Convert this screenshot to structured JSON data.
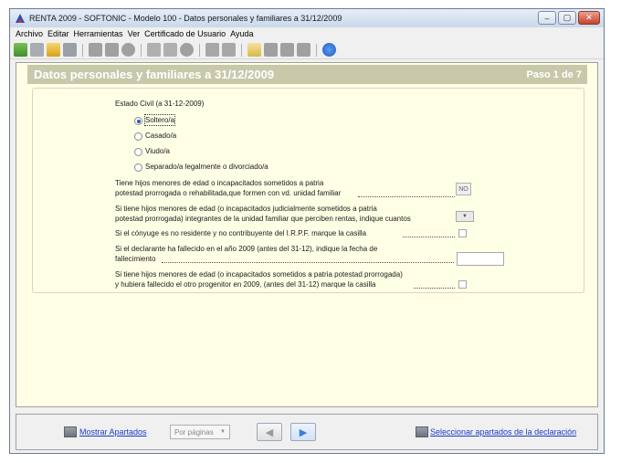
{
  "window": {
    "title": "RENTA 2009 - SOFTONIC - Modelo 100 - Datos personales y familiares a 31/12/2009",
    "minimize": "‒",
    "maximize": "▢",
    "close": "✕"
  },
  "menu": [
    "Archivo",
    "Editar",
    "Herramientas",
    "Ver",
    "Certificado de Usuario",
    "Ayuda"
  ],
  "header": {
    "title": "Datos personales y familiares a 31/12/2009",
    "step": "Paso 1 de 7"
  },
  "form": {
    "estado_civil_label": "Estado Civil (a 31-12-2009)",
    "options": [
      "Soltero/a",
      "Casado/a",
      "Viudo/a",
      "Separado/a legalmente o divorciado/a"
    ],
    "selected_option": "Soltero/a",
    "q1_line1": "Tiene hijos menores de edad o incapacitados sometidos a patria",
    "q1_line2": "potestad prorrogada o rehabilitada,que formen con vd. unidad familiar",
    "q1_value": "NO",
    "q2_line1": "Si tiene hijos menores de edad (o incapacitados judicialmente sometidos a patria",
    "q2_line2": "potestad prorrogada) integrantes de la unidad familiar que perciben rentas, indique cuantos",
    "q3": "Si el cónyuge es no residente y no contribuyente del I.R.P.F. marque la casilla",
    "q4_line1": "Si el declarante ha fallecido en el año 2009 (antes del 31-12), indique la fecha de",
    "q4_line2": "fallecimiento",
    "q5_line1": "Si tiene hijos menores de edad (o incapacitados sometidos a patria potestad prorrogada)",
    "q5_line2": "y hubiera fallecido el otro progenitor en 2009, (antes del 31-12) marque la casilla"
  },
  "bottom": {
    "mostrar": "Mostrar Apartados",
    "view_select": "Por páginas",
    "seleccionar": "Seleccionar apartados de la declaración"
  }
}
